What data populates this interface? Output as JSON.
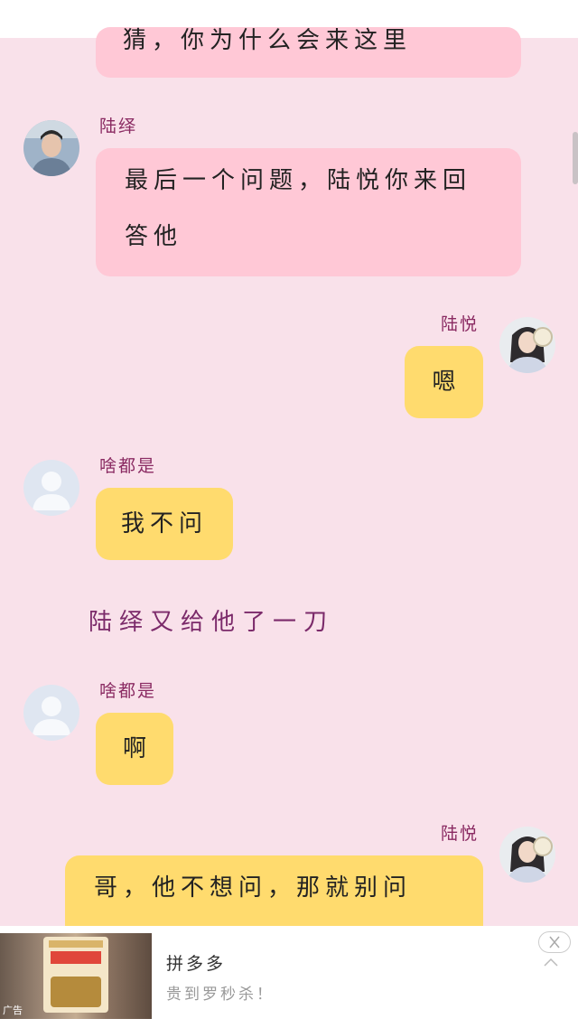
{
  "messages": [
    {
      "type": "left",
      "sender": "",
      "text": "猜，你为什么会来这里",
      "bubble_color": "#ffc8d6"
    },
    {
      "type": "left",
      "sender": "陆绎",
      "text": "最后一个问题，陆悦你来回答他",
      "text_line1": "最后一个问题，陆悦你来回",
      "text_line2": "答他",
      "bubble_color": "#ffc8d6",
      "avatar": "man-avatar-icon"
    },
    {
      "type": "right",
      "sender": "陆悦",
      "text": "嗯",
      "bubble_color": "#ffdb6e",
      "avatar": "woman-avatar-icon"
    },
    {
      "type": "left",
      "sender": "啥都是",
      "text": "我不问",
      "bubble_color": "#ffdb6e",
      "avatar": "default-user-icon"
    },
    {
      "type": "narration",
      "text": "陆绎又给他了一刀"
    },
    {
      "type": "left",
      "sender": "啥都是",
      "text": "啊",
      "bubble_color": "#ffdb6e",
      "avatar": "default-user-icon"
    },
    {
      "type": "right",
      "sender": "陆悦",
      "text": "哥，他不想问，那就别问",
      "bubble_color": "#ffdb6e",
      "avatar": "woman-avatar-icon"
    }
  ],
  "ad": {
    "title": "拼多多",
    "subtitle": "贵到罗秒杀！",
    "tag": "广告",
    "close_icon": "close-icon",
    "collapse_icon": "chevron-up-icon"
  },
  "colors": {
    "background": "#f9e1ea",
    "pink_bubble": "#ffc8d6",
    "yellow_bubble": "#ffdb6e",
    "name": "#8a2a62",
    "narration": "#7b2a6a"
  }
}
